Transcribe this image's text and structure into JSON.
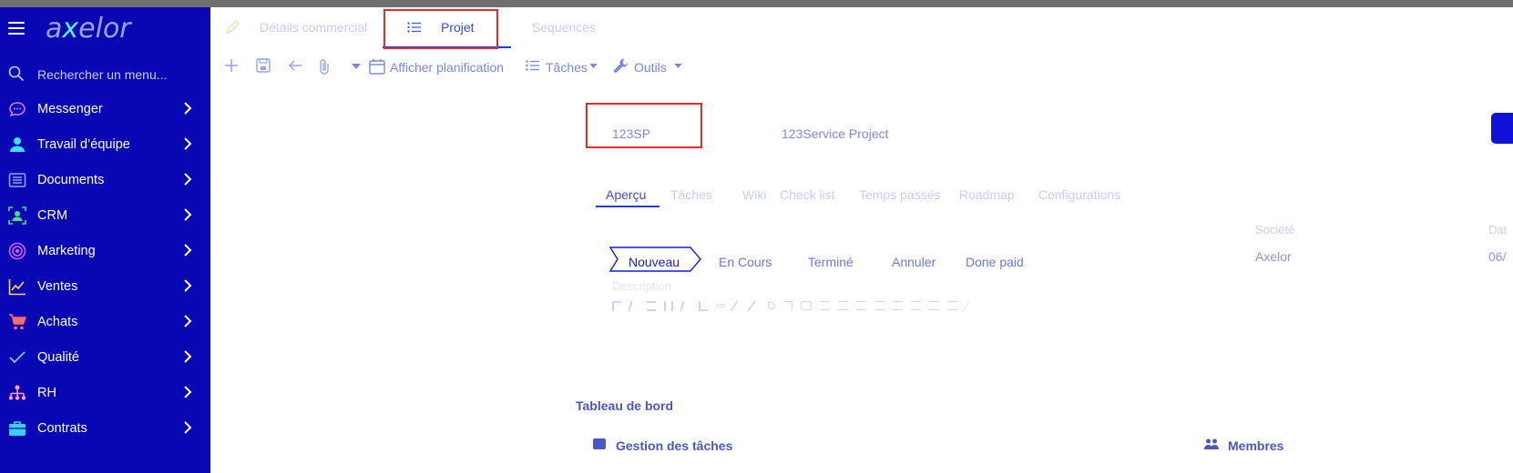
{
  "sidebar": {
    "brand": "axelor",
    "search_placeholder": "Rechercher un menu...",
    "items": [
      {
        "label": "Messenger",
        "icon": "chat-bubble-icon",
        "color": "#c77dff"
      },
      {
        "label": "Travail d’équipe",
        "icon": "person-icon",
        "color": "#3ee0ff"
      },
      {
        "label": "Documents",
        "icon": "document-list-icon",
        "color": "#8fa3ff"
      },
      {
        "label": "CRM",
        "icon": "contact-card-icon",
        "color": "#4ee07a"
      },
      {
        "label": "Marketing",
        "icon": "target-icon",
        "color": "#d35df5"
      },
      {
        "label": "Ventes",
        "icon": "trend-chart-icon",
        "color": "#ffd14d"
      },
      {
        "label": "Achats",
        "icon": "shopping-cart-icon",
        "color": "#ff6b6b"
      },
      {
        "label": "Qualité",
        "icon": "checkmark-icon",
        "color": "#7bc4ff"
      },
      {
        "label": "RH",
        "icon": "org-chart-icon",
        "color": "#ff9ed2"
      },
      {
        "label": "Contrats",
        "icon": "briefcase-icon",
        "color": "#35d1ff"
      }
    ]
  },
  "tabs": {
    "details": "Détails commercial",
    "projet": "Projet",
    "sequences": "Sequences"
  },
  "toolbar": {
    "planning": "Afficher planification",
    "taches": "Tâches",
    "outils": "Outils"
  },
  "record": {
    "code": "123SP",
    "name": "123Service Project"
  },
  "subtabs": [
    "Aperçu",
    "Tâches",
    "Wiki",
    "Check list",
    "Temps passés",
    "Roadmap",
    "Configurations"
  ],
  "statuses": [
    "Nouveau",
    "En Cours",
    "Terminé",
    "Annuler",
    "Done paid"
  ],
  "company": {
    "label": "Société",
    "value": "Axelor",
    "date_label": "Dat",
    "date_value": "06/"
  },
  "description_label": "Description",
  "dashboard": {
    "title": "Tableau de bord",
    "task_panel": "Gestion des tâches",
    "members_panel": "Membres"
  },
  "colors": {
    "sidebar_bg": "#0707b3",
    "accent": "#1010d8",
    "highlight": "#e32b2b"
  }
}
